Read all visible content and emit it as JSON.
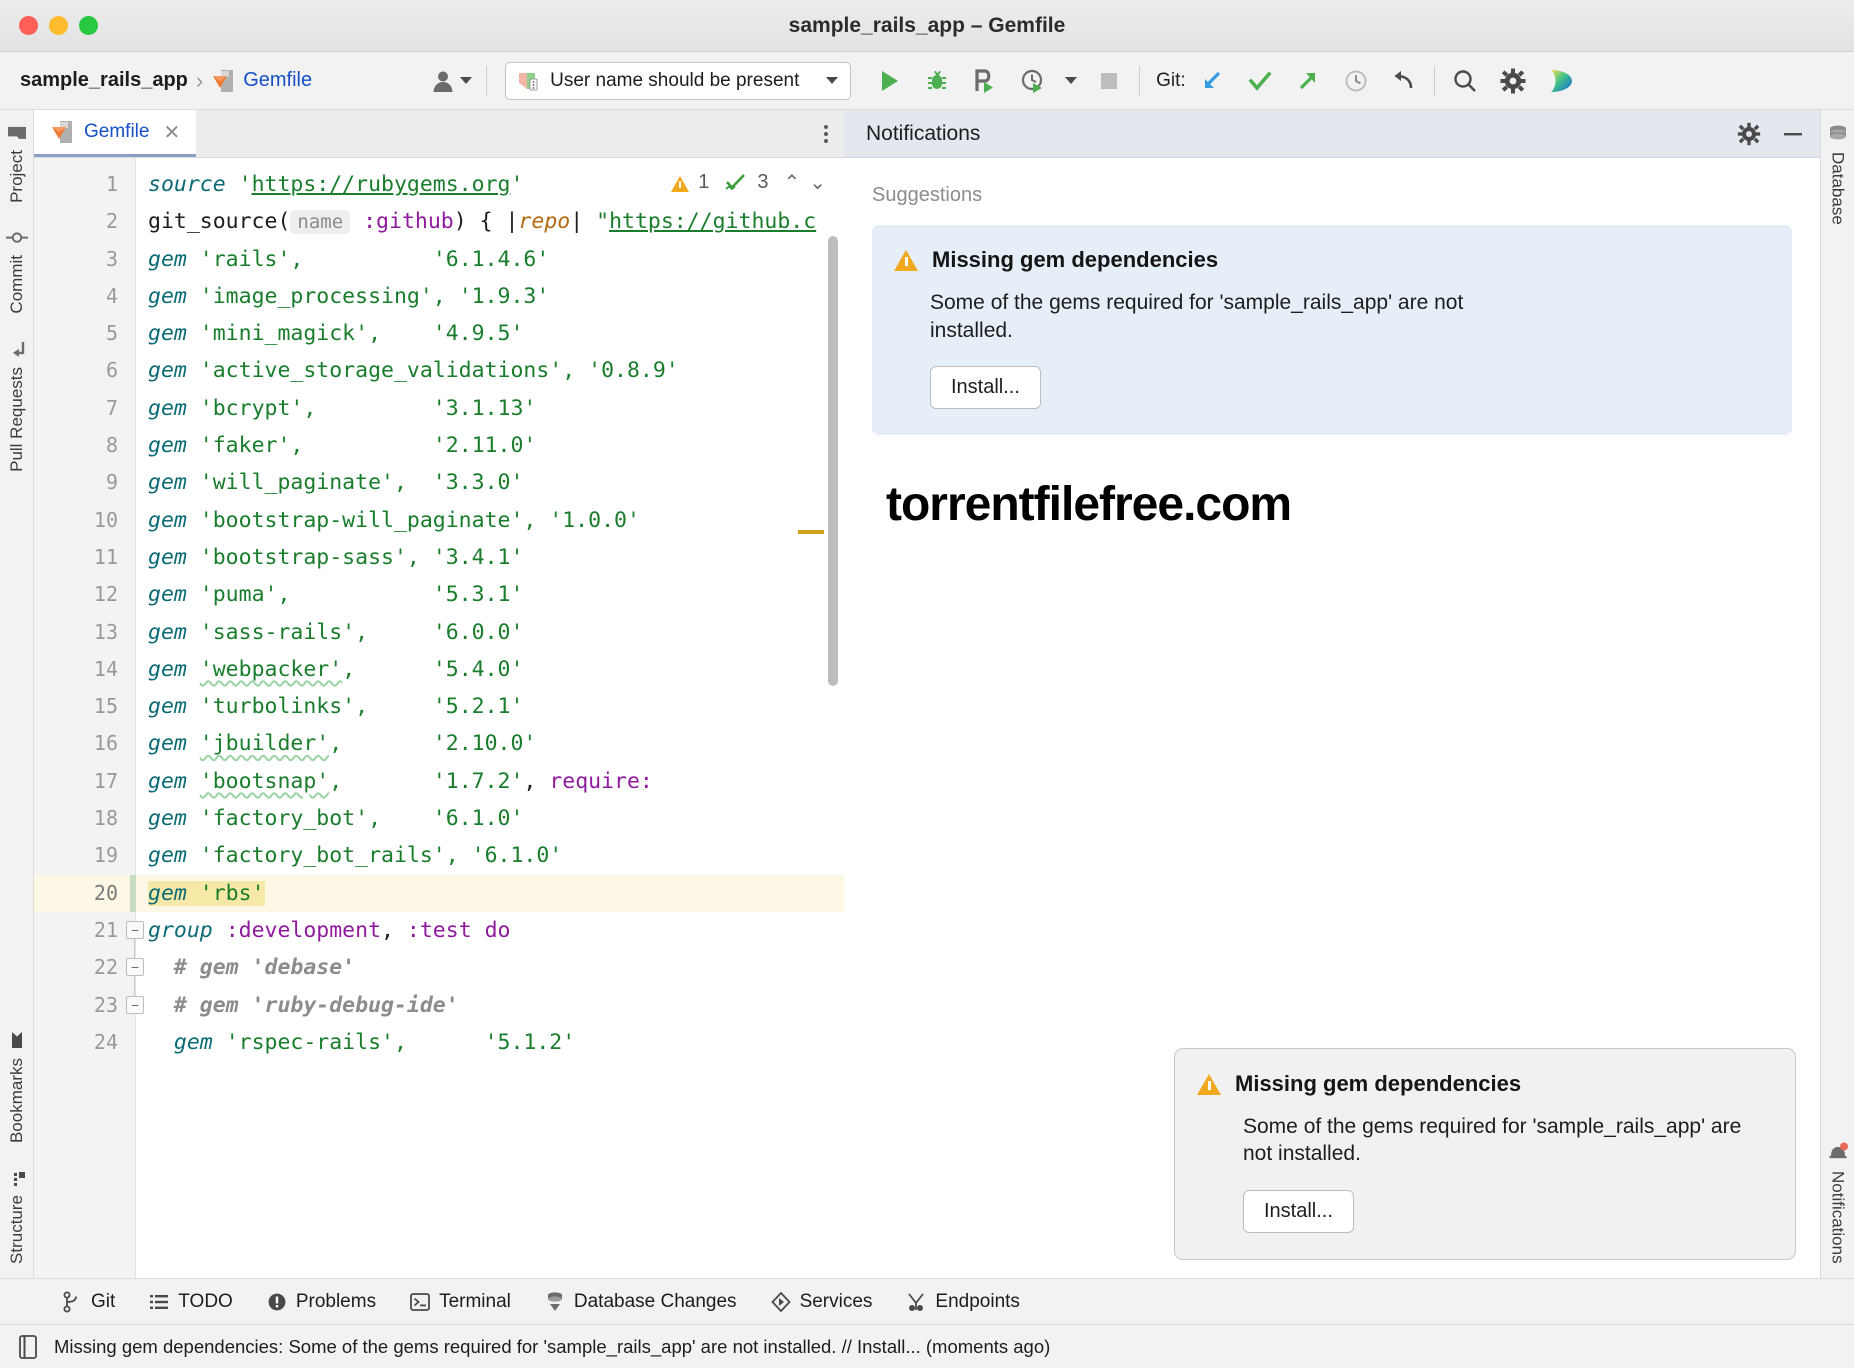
{
  "window": {
    "title": "sample_rails_app – Gemfile",
    "controls": [
      "close",
      "minimize",
      "maximize"
    ]
  },
  "toolbar": {
    "breadcrumb_project": "sample_rails_app",
    "breadcrumb_separator": "›",
    "breadcrumb_file": "Gemfile",
    "avatar_icon": "user-avatar-icon",
    "run_config": "User name should be present",
    "run_icon": "run-icon",
    "debug_icon": "debug-icon",
    "run_coverage_icon": "run-with-coverage-icon",
    "profile_icon": "profiler-icon",
    "stop_icon": "stop-icon",
    "git_label": "Git:",
    "git_update_icon": "update-project-icon",
    "git_commit_icon": "commit-icon",
    "git_push_icon": "push-icon",
    "history_icon": "history-icon",
    "rollback_icon": "rollback-icon",
    "search_icon": "search-everywhere-icon",
    "settings_icon": "gear-icon",
    "ai_icon": "ai-assistant-icon"
  },
  "left_stripe": {
    "top_items": [
      {
        "label": "Project",
        "icon": "folder-icon"
      },
      {
        "label": "Commit",
        "icon": "commit-icon"
      },
      {
        "label": "Pull Requests",
        "icon": "pull-request-icon"
      }
    ],
    "bottom_items": [
      {
        "label": "Bookmarks",
        "icon": "bookmark-icon"
      },
      {
        "label": "Structure",
        "icon": "structure-icon"
      }
    ]
  },
  "right_stripe": {
    "top_items": [
      {
        "label": "Database",
        "icon": "database-icon"
      }
    ],
    "bottom_items": [
      {
        "label": "Notifications",
        "icon": "notifications-icon"
      }
    ]
  },
  "editor": {
    "tab_label": "Gemfile",
    "tab_icon": "ruby-gemfile-icon",
    "tab_close_icon": "close-icon",
    "more_icon": "more-options-icon",
    "inspection": {
      "warning_icon": "warning-triangle-icon",
      "warning_count": "1",
      "ok_icon": "inspections-ok-icon",
      "ok_count": "3",
      "prev_icon": "chevron-up-icon",
      "next_icon": "chevron-down-icon"
    },
    "current_line": 20,
    "lines": [
      {
        "n": 1,
        "tokens": [
          {
            "t": "kw",
            "v": "source"
          },
          {
            "t": "plain",
            "v": " "
          },
          {
            "t": "str",
            "v": "'"
          },
          {
            "t": "strlink",
            "v": "https://rubygems.org"
          },
          {
            "t": "str",
            "v": "'"
          }
        ]
      },
      {
        "n": 2,
        "tokens": [
          {
            "t": "plain",
            "v": "git_source("
          },
          {
            "t": "hint",
            "v": "name"
          },
          {
            "t": "plain",
            "v": " "
          },
          {
            "t": "sym",
            "v": ":github"
          },
          {
            "t": "plain",
            "v": ") { |"
          },
          {
            "t": "var",
            "v": "repo"
          },
          {
            "t": "plain",
            "v": "| "
          },
          {
            "t": "str",
            "v": "\""
          },
          {
            "t": "strlink",
            "v": "https://github.c"
          }
        ]
      },
      {
        "n": 3,
        "tokens": [
          {
            "t": "kw",
            "v": "gem"
          },
          {
            "t": "plain",
            "v": " "
          },
          {
            "t": "str",
            "v": "'rails',"
          },
          {
            "t": "plain",
            "v": "          "
          },
          {
            "t": "str",
            "v": "'6.1.4.6'"
          }
        ]
      },
      {
        "n": 4,
        "tokens": [
          {
            "t": "kw",
            "v": "gem"
          },
          {
            "t": "plain",
            "v": " "
          },
          {
            "t": "str",
            "v": "'image_processing',"
          },
          {
            "t": "plain",
            "v": " "
          },
          {
            "t": "str",
            "v": "'1.9.3'"
          }
        ]
      },
      {
        "n": 5,
        "tokens": [
          {
            "t": "kw",
            "v": "gem"
          },
          {
            "t": "plain",
            "v": " "
          },
          {
            "t": "str",
            "v": "'mini_magick',"
          },
          {
            "t": "plain",
            "v": "    "
          },
          {
            "t": "str",
            "v": "'4.9.5'"
          }
        ]
      },
      {
        "n": 6,
        "tokens": [
          {
            "t": "kw",
            "v": "gem"
          },
          {
            "t": "plain",
            "v": " "
          },
          {
            "t": "str",
            "v": "'active_storage_validations',"
          },
          {
            "t": "plain",
            "v": " "
          },
          {
            "t": "str",
            "v": "'0.8.9'"
          }
        ]
      },
      {
        "n": 7,
        "tokens": [
          {
            "t": "kw",
            "v": "gem"
          },
          {
            "t": "plain",
            "v": " "
          },
          {
            "t": "str",
            "v": "'bcrypt',"
          },
          {
            "t": "plain",
            "v": "         "
          },
          {
            "t": "str",
            "v": "'3.1.13'"
          }
        ]
      },
      {
        "n": 8,
        "tokens": [
          {
            "t": "kw",
            "v": "gem"
          },
          {
            "t": "plain",
            "v": " "
          },
          {
            "t": "str",
            "v": "'faker',"
          },
          {
            "t": "plain",
            "v": "          "
          },
          {
            "t": "str",
            "v": "'2.11.0'"
          }
        ]
      },
      {
        "n": 9,
        "tokens": [
          {
            "t": "kw",
            "v": "gem"
          },
          {
            "t": "plain",
            "v": " "
          },
          {
            "t": "str",
            "v": "'will_paginate',"
          },
          {
            "t": "plain",
            "v": "  "
          },
          {
            "t": "str",
            "v": "'3.3.0'"
          }
        ]
      },
      {
        "n": 10,
        "tokens": [
          {
            "t": "kw",
            "v": "gem"
          },
          {
            "t": "plain",
            "v": " "
          },
          {
            "t": "str",
            "v": "'bootstrap-will_paginate',"
          },
          {
            "t": "plain",
            "v": " "
          },
          {
            "t": "str",
            "v": "'1.0.0'"
          }
        ]
      },
      {
        "n": 11,
        "tokens": [
          {
            "t": "kw",
            "v": "gem"
          },
          {
            "t": "plain",
            "v": " "
          },
          {
            "t": "str",
            "v": "'bootstrap-sass',"
          },
          {
            "t": "plain",
            "v": " "
          },
          {
            "t": "str",
            "v": "'3.4.1'"
          }
        ]
      },
      {
        "n": 12,
        "tokens": [
          {
            "t": "kw",
            "v": "gem"
          },
          {
            "t": "plain",
            "v": " "
          },
          {
            "t": "str",
            "v": "'puma',"
          },
          {
            "t": "plain",
            "v": "           "
          },
          {
            "t": "str",
            "v": "'5.3.1'"
          }
        ]
      },
      {
        "n": 13,
        "tokens": [
          {
            "t": "kw",
            "v": "gem"
          },
          {
            "t": "plain",
            "v": " "
          },
          {
            "t": "str",
            "v": "'sass-rails',"
          },
          {
            "t": "plain",
            "v": "     "
          },
          {
            "t": "str",
            "v": "'6.0.0'"
          }
        ]
      },
      {
        "n": 14,
        "tokens": [
          {
            "t": "kw",
            "v": "gem"
          },
          {
            "t": "plain",
            "v": " "
          },
          {
            "t": "wavy",
            "v": "'webpacker'"
          },
          {
            "t": "str",
            "v": ","
          },
          {
            "t": "plain",
            "v": "      "
          },
          {
            "t": "str",
            "v": "'5.4.0'"
          }
        ]
      },
      {
        "n": 15,
        "tokens": [
          {
            "t": "kw",
            "v": "gem"
          },
          {
            "t": "plain",
            "v": " "
          },
          {
            "t": "str",
            "v": "'turbolinks',"
          },
          {
            "t": "plain",
            "v": "     "
          },
          {
            "t": "str",
            "v": "'5.2.1'"
          }
        ]
      },
      {
        "n": 16,
        "tokens": [
          {
            "t": "kw",
            "v": "gem"
          },
          {
            "t": "plain",
            "v": " "
          },
          {
            "t": "wavy",
            "v": "'jbuilder'"
          },
          {
            "t": "str",
            "v": ","
          },
          {
            "t": "plain",
            "v": "       "
          },
          {
            "t": "str",
            "v": "'2.10.0'"
          }
        ]
      },
      {
        "n": 17,
        "tokens": [
          {
            "t": "kw",
            "v": "gem"
          },
          {
            "t": "plain",
            "v": " "
          },
          {
            "t": "wavy",
            "v": "'bootsnap'"
          },
          {
            "t": "str",
            "v": ","
          },
          {
            "t": "plain",
            "v": "       "
          },
          {
            "t": "str",
            "v": "'1.7.2'"
          },
          {
            "t": "plain",
            "v": ", "
          },
          {
            "t": "sym",
            "v": "require:"
          }
        ]
      },
      {
        "n": 18,
        "tokens": [
          {
            "t": "kw",
            "v": "gem"
          },
          {
            "t": "plain",
            "v": " "
          },
          {
            "t": "str",
            "v": "'factory_bot',"
          },
          {
            "t": "plain",
            "v": "    "
          },
          {
            "t": "str",
            "v": "'6.1.0'"
          }
        ]
      },
      {
        "n": 19,
        "tokens": [
          {
            "t": "kw",
            "v": "gem"
          },
          {
            "t": "plain",
            "v": " "
          },
          {
            "t": "str",
            "v": "'factory_bot_rails',"
          },
          {
            "t": "plain",
            "v": " "
          },
          {
            "t": "str",
            "v": "'6.1.0'"
          }
        ]
      },
      {
        "n": 20,
        "tokens": [
          {
            "t": "selkw",
            "v": "gem"
          },
          {
            "t": "selplain",
            "v": " "
          },
          {
            "t": "selstr",
            "v": "'rbs'"
          }
        ]
      },
      {
        "n": 21,
        "tokens": [
          {
            "t": "kw",
            "v": "group"
          },
          {
            "t": "plain",
            "v": " "
          },
          {
            "t": "sym",
            "v": ":development"
          },
          {
            "t": "plain",
            "v": ", "
          },
          {
            "t": "sym",
            "v": ":test"
          },
          {
            "t": "plain",
            "v": " "
          },
          {
            "t": "kwb",
            "v": "do"
          }
        ]
      },
      {
        "n": 22,
        "tokens": [
          {
            "t": "plain",
            "v": "  "
          },
          {
            "t": "cmt",
            "v": "# gem 'debase'"
          }
        ]
      },
      {
        "n": 23,
        "tokens": [
          {
            "t": "plain",
            "v": "  "
          },
          {
            "t": "cmt",
            "v": "# gem 'ruby-debug-ide'"
          }
        ]
      },
      {
        "n": 24,
        "tokens": [
          {
            "t": "plain",
            "v": "  "
          },
          {
            "t": "kw",
            "v": "gem"
          },
          {
            "t": "plain",
            "v": " "
          },
          {
            "t": "str",
            "v": "'rspec-rails',"
          },
          {
            "t": "plain",
            "v": "      "
          },
          {
            "t": "str",
            "v": "'5.1.2'"
          }
        ]
      }
    ]
  },
  "notifications": {
    "panel_title": "Notifications",
    "gear_icon": "gear-icon",
    "minimize_icon": "minimize-icon",
    "section_label": "Suggestions",
    "suggestion": {
      "icon": "warning-triangle-icon",
      "title": "Missing gem dependencies",
      "text": "Some of the gems required for 'sample_rails_app' are not installed.",
      "action": "Install..."
    },
    "watermark": "torrentfilefree.com",
    "balloon": {
      "icon": "warning-triangle-icon",
      "title": "Missing gem dependencies",
      "text": "Some of the gems required for 'sample_rails_app' are not installed.",
      "action": "Install..."
    }
  },
  "bottom_toolwindows": [
    {
      "label": "Git",
      "icon": "git-branch-icon"
    },
    {
      "label": "TODO",
      "icon": "todo-list-icon"
    },
    {
      "label": "Problems",
      "icon": "problems-icon"
    },
    {
      "label": "Terminal",
      "icon": "terminal-icon"
    },
    {
      "label": "Database Changes",
      "icon": "database-changes-icon"
    },
    {
      "label": "Services",
      "icon": "services-icon"
    },
    {
      "label": "Endpoints",
      "icon": "endpoints-icon"
    }
  ],
  "statusbar": {
    "icon": "event-log-icon",
    "message": "Missing gem dependencies: Some of the gems required for 'sample_rails_app' are not installed. // Install... (moments ago)"
  }
}
